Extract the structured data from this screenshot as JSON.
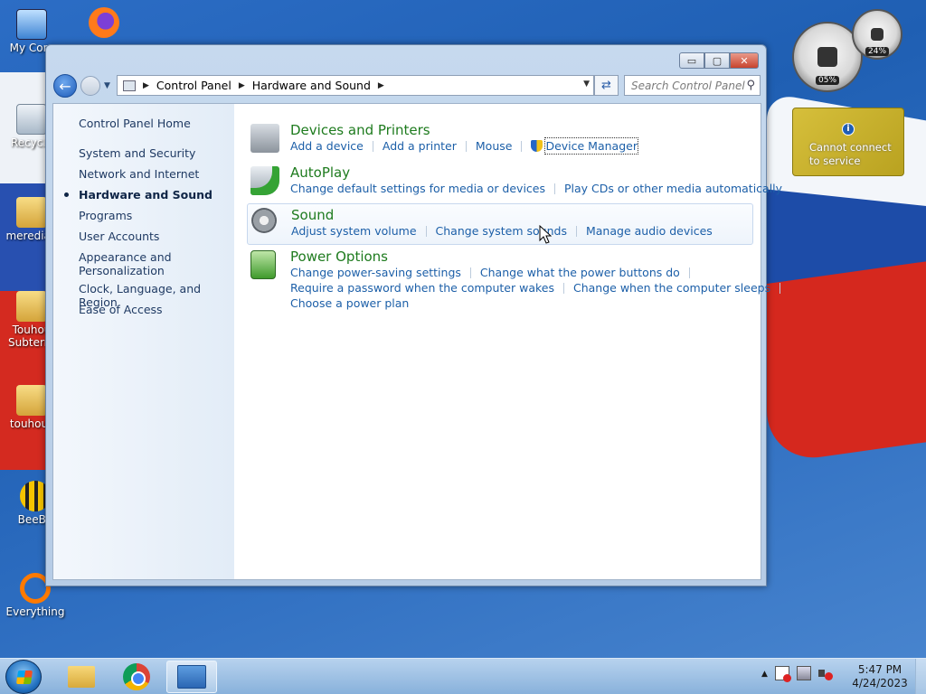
{
  "desktop": {
    "icons": [
      {
        "label": "My Com"
      },
      {
        "label": "Recycle"
      },
      {
        "label": "meredian"
      },
      {
        "label": "Touhou Subterra"
      },
      {
        "label": "touhou_"
      },
      {
        "label": "BeeBE"
      },
      {
        "label": "Everything"
      }
    ],
    "gadgets": {
      "cpu_value": "05%",
      "mem_value": "24%",
      "weather_message": "Cannot connect to service"
    }
  },
  "window": {
    "controls": {
      "minimize": "▭",
      "maximize": "▢",
      "close": "✕"
    },
    "breadcrumb": [
      "Control Panel",
      "Hardware and Sound"
    ],
    "search_placeholder": "Search Control Panel"
  },
  "sidebar": {
    "items": [
      {
        "label": "Control Panel Home"
      },
      {
        "label": "System and Security"
      },
      {
        "label": "Network and Internet"
      },
      {
        "label": "Hardware and Sound",
        "active": true
      },
      {
        "label": "Programs"
      },
      {
        "label": "User Accounts"
      },
      {
        "label": "Appearance and Personalization"
      },
      {
        "label": "Clock, Language, and Region"
      },
      {
        "label": "Ease of Access"
      }
    ]
  },
  "categories": [
    {
      "title": "Devices and Printers",
      "links": [
        "Add a device",
        "Add a printer",
        "Mouse",
        "Device Manager"
      ]
    },
    {
      "title": "AutoPlay",
      "links": [
        "Change default settings for media or devices",
        "Play CDs or other media automatically"
      ]
    },
    {
      "title": "Sound",
      "links": [
        "Adjust system volume",
        "Change system sounds",
        "Manage audio devices"
      ]
    },
    {
      "title": "Power Options",
      "links": [
        "Change power-saving settings",
        "Change what the power buttons do",
        "Require a password when the computer wakes",
        "Change when the computer sleeps",
        "Choose a power plan"
      ]
    }
  ],
  "taskbar": {
    "clock_time": "5:47 PM",
    "clock_date": "4/24/2023",
    "tray_chevron": "▲"
  }
}
